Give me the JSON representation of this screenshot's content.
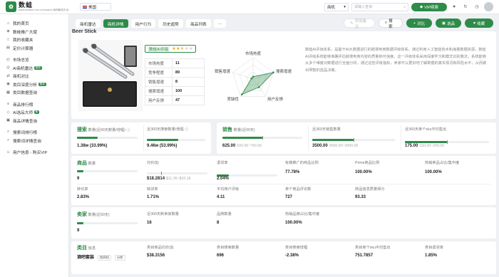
{
  "app": {
    "logo_name": "数蛙",
    "logo_sub": "www.amzshu.com.cn Amazon 商机敏选平台"
  },
  "topbar": {
    "market": "美国",
    "search_type": "商机",
    "search_placeholder": "请输入查询",
    "vip_label": "VIP续费"
  },
  "sidebar": {
    "items": [
      {
        "icon": "⌂",
        "label": "我的首页"
      },
      {
        "icon": "◈",
        "label": "数蛙推广大使"
      },
      {
        "icon": "☆",
        "label": "我的收藏夹"
      },
      {
        "icon": "▤",
        "label": "定价计算器"
      },
      {
        "icon": "◴",
        "label": "市场总览"
      },
      {
        "icon": "◎",
        "label": "AI商机雷达",
        "badge": "推荐"
      },
      {
        "icon": "⇄",
        "label": "商机对比"
      },
      {
        "icon": "◉",
        "label": "类目深度分析",
        "badge": "推荐"
      },
      {
        "icon": "▦",
        "label": "类目数据查询"
      },
      {
        "icon": "≡",
        "label": "商品排行榜"
      },
      {
        "icon": "◇",
        "label": "AI选品大师",
        "badge": "新"
      },
      {
        "icon": "▣",
        "label": "商品详情查询"
      },
      {
        "icon": "⌕",
        "label": "搜索词排行榜"
      },
      {
        "icon": "⌕",
        "label": "搜索词详情查询"
      },
      {
        "icon": "☺",
        "label": "用户信息 - 购买VIP"
      }
    ]
  },
  "tabs": [
    {
      "label": "商机雷达",
      "active": false
    },
    {
      "label": "商机详情",
      "active": true
    },
    {
      "label": "用户行为",
      "active": false
    },
    {
      "label": "历史趋势",
      "active": false
    },
    {
      "label": "商品列表",
      "active": false
    },
    {
      "label": "...",
      "active": false
    }
  ],
  "actions": {
    "add_note": "添加备注",
    "search": "搜索",
    "compare": "对比",
    "select": "选品",
    "favorite": "收藏"
  },
  "product": {
    "title": "Beer Stick",
    "rating_tag": "数蛙AI评级",
    "stars": 2.5,
    "metrics": [
      {
        "label": "市场热度",
        "value": "11"
      },
      {
        "label": "竞争程度",
        "value": "89"
      },
      {
        "label": "销售增速",
        "value": "8"
      },
      {
        "label": "搜索增速",
        "value": "100"
      },
      {
        "label": "用户反馈",
        "value": "47"
      }
    ],
    "radar_labels": [
      "市场热度",
      "搜索增速",
      "用户反馈",
      "竞缺性",
      "销售增速"
    ],
    "description": "数蛙AI评级体系，是基于AI大数据进行的跨境电商数据评级体系。通过利用人工智能技术和海量数据资源，数蛙AI评级系统能够准确评估跨境电商内容的质量和可信度。这一评级体系采用深度学习和模式识别算法，系统能够从多个维度对数据进行全面分析。通过这些评级指标，卖家可以更好地了解数据的真实情况和风险水平，从而做出明智的选品决策。"
  },
  "search_card": {
    "title": "搜索",
    "sub": "数量(近90天数量/增幅)",
    "value": "1.38w (33.99%)",
    "c2_label": "近360天搜索数量/增幅",
    "c2_value": "9.46w (53.99%)"
  },
  "sales_card": {
    "title": "销售",
    "sub": "数量(近90天)",
    "value": "625.00",
    "range": "500.00~750.00",
    "c2_label": "近360天销售数量",
    "c2_value": "3500.00",
    "c2_range": "3000.00~3000.00",
    "c3_label": "近360天单个sku平均售出",
    "c3_value": "175.00",
    "c3_range": "150.00~200.00"
  },
  "goods_card": {
    "title": "商品",
    "sub": "数量",
    "count": "9",
    "price_label": "均价($)",
    "price_value": "$18.2814",
    "price_range": "$11.36~$33.18",
    "return_label": "退货率",
    "return_value": "2.04%",
    "ad_label": "有做推广的商品比例",
    "ad_value": "77.78%",
    "prime_label": "Prime商品比例",
    "prime_value": "100.00%",
    "hot_label": "热销商品占比/集中度",
    "hot_value": "100.00%",
    "conv_label": "转化率",
    "conv_value": "2.83%",
    "oos_label": "缺货率",
    "oos_value": "1.71%",
    "avg_rating_label": "平均用户评级",
    "avg_rating_value": "4.11",
    "reviews_label": "单个商品评论数",
    "reviews_value": "727",
    "quality_label": "商品信息质量得分",
    "quality_value": "93.33"
  },
  "seller_card": {
    "title": "卖家",
    "sub": "数量(近90天)",
    "count": "9",
    "new_label": "近360天新卖家数量",
    "new_value": "16",
    "brand_label": "品牌数量",
    "brand_value": "8",
    "hot_label": "热销品牌占比/集中度",
    "hot_value": "100.00%"
  },
  "category_card": {
    "title": "类目",
    "sub": "信息",
    "name": "酒吧套装",
    "chip1": "找商机",
    "chip2": "分析",
    "price_label": "类目商品均价($)",
    "price_value": "$38.3156",
    "search_label": "类目搜索数量",
    "search_value": "696",
    "growth_label": "类目搜索增幅",
    "growth_value": "-2.38%",
    "sku_label": "类目单个sku平均售出",
    "sku_value": "751.7857",
    "return_label": "类目退货率",
    "return_value": "1.85%"
  },
  "bars": {
    "search_90": 0.34,
    "search_360": 0.54,
    "sales": 0.5,
    "sales_360": 0.5,
    "sales_sku": 0.5,
    "goods": 0.1,
    "return": 0.2,
    "seller": 0.1
  }
}
